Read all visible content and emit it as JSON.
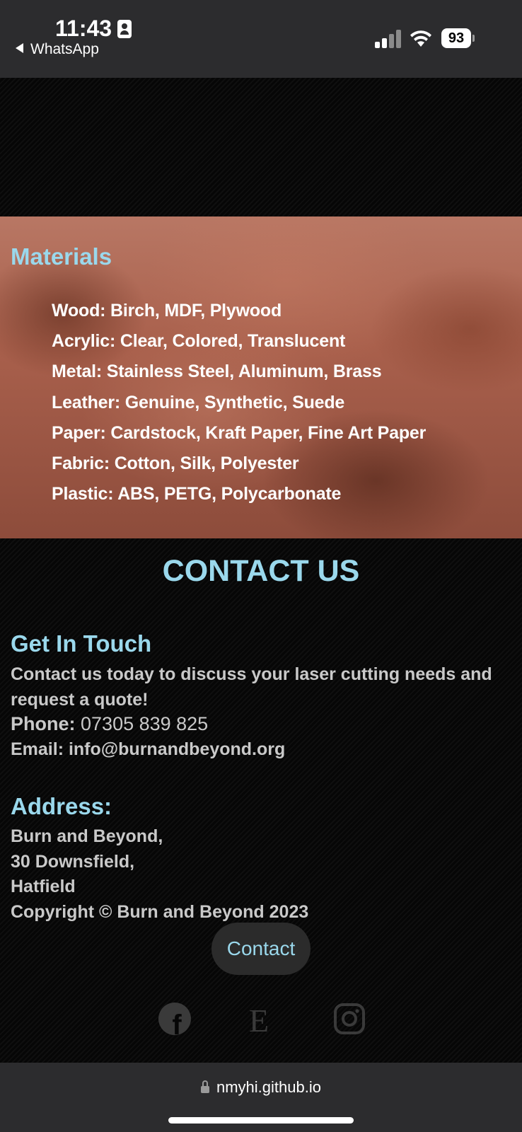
{
  "status_bar": {
    "time": "11:43",
    "back_app": "WhatsApp",
    "battery": "93"
  },
  "materials": {
    "title": "Materials",
    "items": [
      "Wood: Birch, MDF, Plywood",
      "Acrylic: Clear, Colored, Translucent",
      "Metal: Stainless Steel, Aluminum, Brass",
      "Leather: Genuine, Synthetic, Suede",
      "Paper: Cardstock, Kraft Paper, Fine Art Paper",
      "Fabric: Cotton, Silk, Polyester",
      "Plastic: ABS, PETG, Polycarbonate"
    ]
  },
  "contact": {
    "title": "CONTACT US",
    "get_in_touch_title": "Get In Touch",
    "intro": "Contact us today to discuss your laser cutting needs and request a quote!",
    "phone_label": "Phone:",
    "phone_value": "07305 839 825",
    "email": "Email: info@burnandbeyond.org",
    "address_title": "Address:",
    "address_lines": [
      "Burn and Beyond,",
      "30 Downsfield,",
      "Hatfield"
    ],
    "copyright": "Copyright © Burn and Beyond 2023",
    "button_label": "Contact"
  },
  "social": {
    "facebook_letter": "f",
    "etsy_letter": "E"
  },
  "browser": {
    "url": "nmyhi.github.io"
  },
  "colors": {
    "accent": "#9ad8ec",
    "text": "#c9c9c9",
    "background": "#060606"
  }
}
